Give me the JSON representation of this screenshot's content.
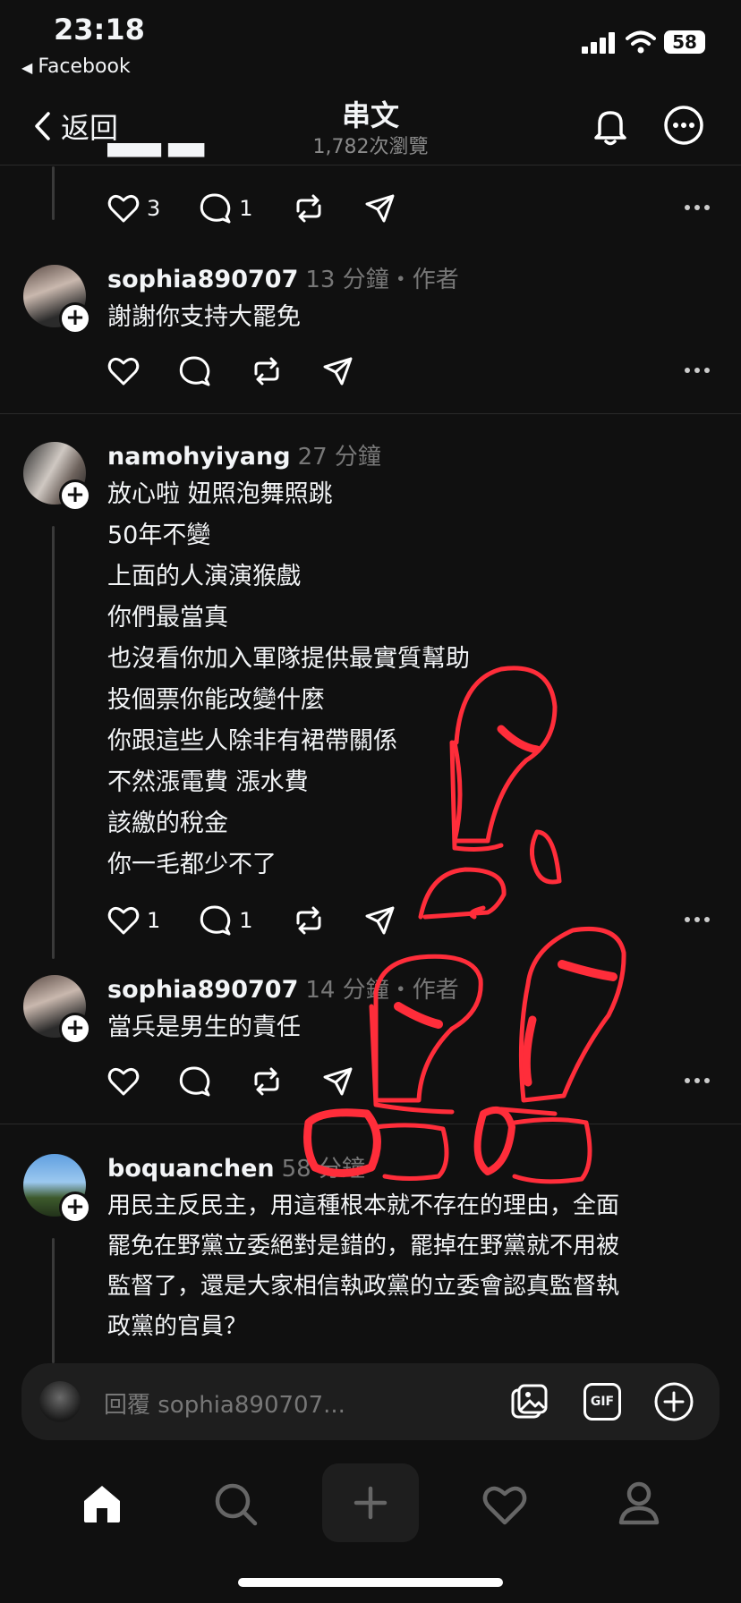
{
  "status_bar": {
    "time": "23:18",
    "back_app": "Facebook",
    "battery": "58"
  },
  "header": {
    "back_label": "返回",
    "title": "串文",
    "views": "1,782次瀏覽"
  },
  "colors": {
    "background": "#101010",
    "muted": "#777777",
    "scribble": "#ff2d3a"
  },
  "partial_top": {
    "likes": "3",
    "replies": "1"
  },
  "comments": [
    {
      "username": "sophia890707",
      "meta": "13 分鐘・作者",
      "text": "謝謝你支持大罷免",
      "likes": "",
      "replies": ""
    },
    {
      "username": "namohyiyang",
      "meta": "27 分鐘",
      "text": "放心啦 妞照泡舞照跳\n50年不變\n上面的人演演猴戲\n你們最當真\n也沒看你加入軍隊提供最實質幫助\n投個票你能改變什麼\n你跟這些人除非有裙帶關係\n不然漲電費 漲水費\n該繳的稅金\n你一毛都少不了",
      "likes": "1",
      "replies": "1"
    },
    {
      "username": "sophia890707",
      "meta": "14 分鐘・作者",
      "text": "當兵是男生的責任",
      "likes": "",
      "replies": ""
    },
    {
      "username": "boquanchen",
      "meta": "58 分鐘",
      "text": "用民主反民主，用這種根本就不存在的理由，全面\n罷免在野黨立委絕對是錯的，罷掉在野黨就不用被\n監督了，還是大家相信執政黨的立委會認真監督執\n政黨的官員？",
      "likes": "",
      "replies": ""
    }
  ],
  "reply_box": {
    "placeholder": "回覆 sophia890707..."
  },
  "icons": [
    "bell-icon",
    "more-circle-icon",
    "heart-icon",
    "comment-icon",
    "repost-icon",
    "share-icon",
    "image-icon",
    "gif-icon",
    "plus-circle-icon",
    "home-icon",
    "search-icon",
    "create-icon",
    "activity-icon",
    "profile-icon"
  ]
}
